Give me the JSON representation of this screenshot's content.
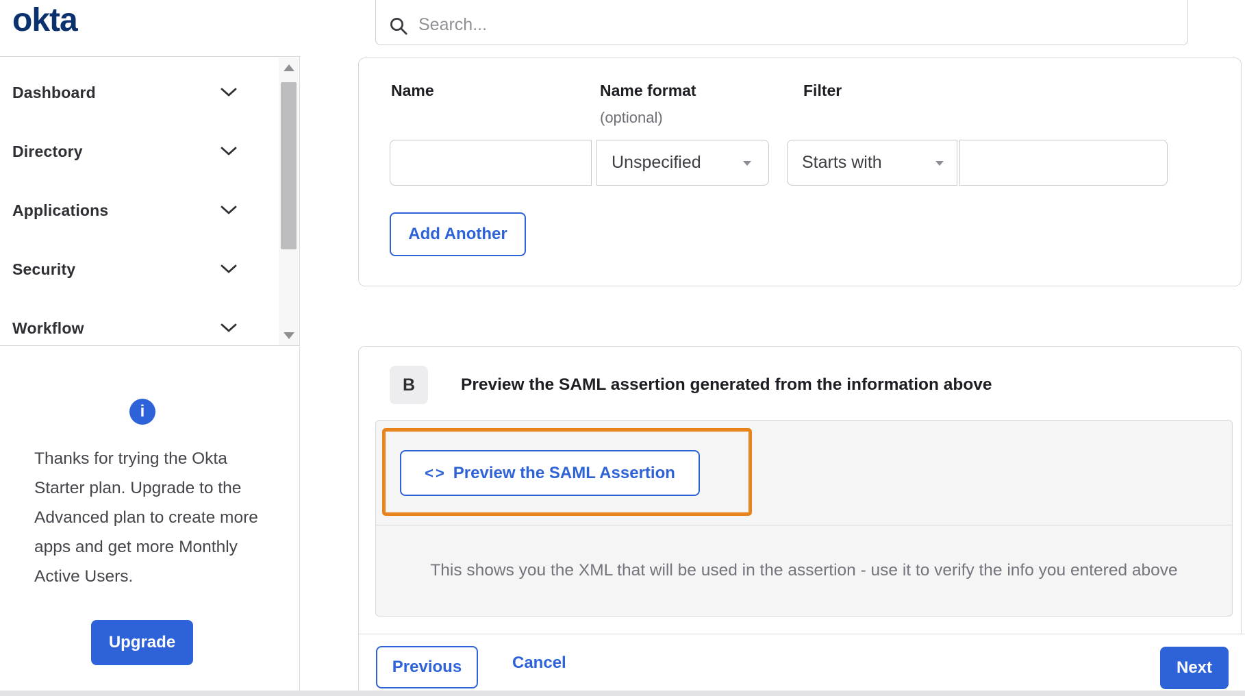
{
  "brand": {
    "logo_text": "okta"
  },
  "topbar": {
    "search_placeholder": "Search..."
  },
  "sidebar": {
    "items": [
      {
        "label": "Dashboard"
      },
      {
        "label": "Directory"
      },
      {
        "label": "Applications"
      },
      {
        "label": "Security"
      },
      {
        "label": "Workflow"
      }
    ],
    "upgrade": {
      "message": "Thanks for trying the Okta Starter plan. Upgrade to the Advanced plan to create more apps and get more Monthly Active Users.",
      "button_label": "Upgrade"
    }
  },
  "attribute_form": {
    "headers": {
      "name": "Name",
      "name_format": "Name format",
      "name_format_note": "(optional)",
      "filter": "Filter"
    },
    "row": {
      "name_value": "",
      "name_format_selected": "Unspecified",
      "filter_operator_selected": "Starts with",
      "filter_value": ""
    },
    "add_another_label": "Add Another"
  },
  "preview_section": {
    "step_badge": "B",
    "heading": "Preview the SAML assertion generated from the information above",
    "preview_button": {
      "icon": "<>",
      "label": "Preview the SAML Assertion"
    },
    "hint": "This shows you the XML that will be used in the assertion - use it to verify the info you entered above"
  },
  "wizard_footer": {
    "previous_label": "Previous",
    "cancel_label": "Cancel",
    "next_label": "Next"
  },
  "colors": {
    "accent_blue": "#2e62d9",
    "brand_navy": "#0b306e",
    "highlight_orange": "#e8831d"
  }
}
